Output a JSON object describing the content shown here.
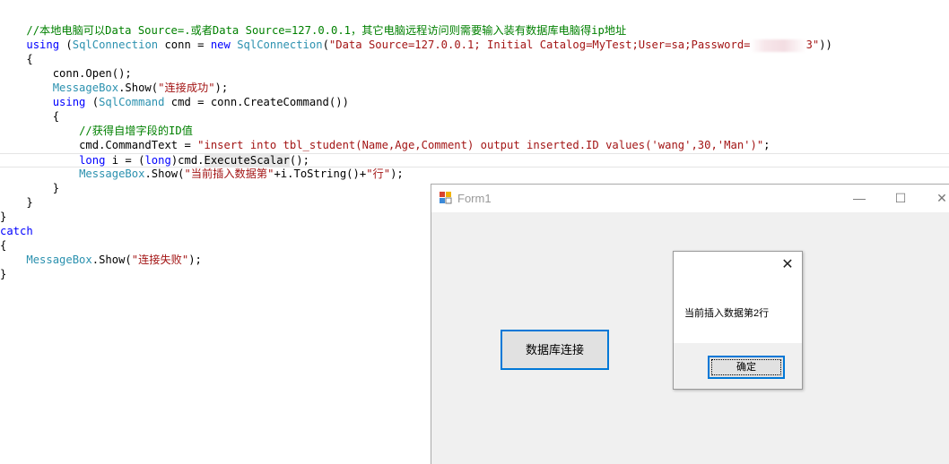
{
  "code": {
    "l1_comment": "//本地电脑可以Data Source=.或者Data Source=127.0.0.1，其它电脑远程访问则需要输入装有数据库电脑得ip地址",
    "l2_using": "using",
    "l2_p1": " (",
    "l2_type": "SqlConnection",
    "l2_p2": " conn = ",
    "l2_new": "new",
    "l2_p3": " ",
    "l2_type2": "SqlConnection",
    "l2_p4": "(",
    "l2_str": "\"Data Source=127.0.0.1; Initial Catalog=MyTest;User=sa;Password=",
    "l2_strend": "3\"",
    "l2_p5": "))",
    "l3": "{",
    "l4": "conn.Open();",
    "l5_type": "MessageBox",
    "l5_p1": ".Show(",
    "l5_str": "\"连接成功\"",
    "l5_p2": ");",
    "l6_using": "using",
    "l6_p1": " (",
    "l6_type": "SqlCommand",
    "l6_p2": " cmd = conn.CreateCommand())",
    "l7": "{",
    "l8_comment": "//获得自增字段的ID值",
    "l9_p1": "cmd.CommandText = ",
    "l9_str": "\"insert into tbl_student(Name,Age,Comment) output inserted.ID values('wang',30,'Man')\"",
    "l9_p2": ";",
    "l10_kw": "long",
    "l10_p1": " i = (",
    "l10_kw2": "long",
    "l10_p2": ")cmd.",
    "l10_hl": "ExecuteScalar",
    "l10_p3": "();",
    "l11_type": "MessageBox",
    "l11_p1": ".Show(",
    "l11_str": "\"当前插入数据第\"",
    "l11_p2": "+i.ToString()+",
    "l11_str2": "\"行\"",
    "l11_p3": ");",
    "l12": "}",
    "l13": "}",
    "l14": "}",
    "l15_kw": "catch",
    "l16": "{",
    "l17_type": "MessageBox",
    "l17_p1": ".Show(",
    "l17_str": "\"连接失败\"",
    "l17_p2": ");",
    "l18": "}"
  },
  "form": {
    "title": "Form1",
    "minimize_glyph": "—",
    "maximize_glyph": "☐",
    "close_glyph": "✕",
    "main_button": "数据库连接"
  },
  "messagebox": {
    "close_glyph": "✕",
    "text": "当前插入数据第2行",
    "ok_label": "确定"
  },
  "colors": {
    "keyword": "#0000ff",
    "type": "#2b91af",
    "string": "#a31515",
    "comment": "#008000",
    "focus_border": "#0078d7"
  }
}
